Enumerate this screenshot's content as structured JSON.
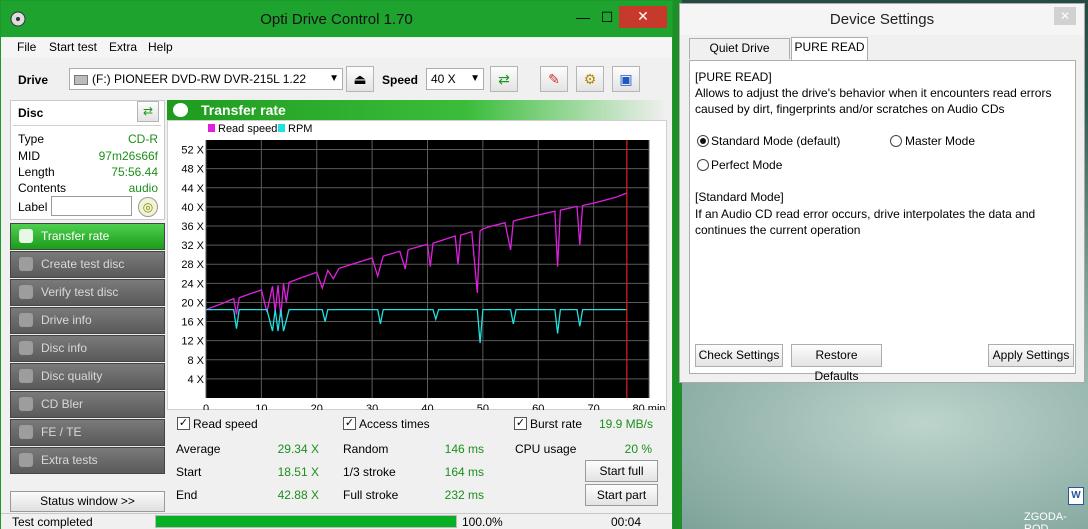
{
  "main_window": {
    "title": "Opti Drive Control 1.70",
    "menu": [
      "File",
      "Start test",
      "Extra",
      "Help"
    ],
    "drive_label": "Drive",
    "drive_value": "(F:)  PIONEER DVD-RW  DVR-215L 1.22",
    "speed_label": "Speed",
    "speed_value": "40 X",
    "disc": {
      "title": "Disc",
      "rows": [
        {
          "key": "Type",
          "value": "CD-R"
        },
        {
          "key": "MID",
          "value": "97m26s66f"
        },
        {
          "key": "Length",
          "value": "75:56.44"
        },
        {
          "key": "Contents",
          "value": "audio"
        }
      ],
      "label_key": "Label",
      "label_value": ""
    },
    "nav": [
      {
        "label": "Transfer rate",
        "active": true
      },
      {
        "label": "Create test disc",
        "active": false
      },
      {
        "label": "Verify test disc",
        "active": false
      },
      {
        "label": "Drive info",
        "active": false
      },
      {
        "label": "Disc info",
        "active": false
      },
      {
        "label": "Disc quality",
        "active": false
      },
      {
        "label": "CD Bler",
        "active": false
      },
      {
        "label": "FE / TE",
        "active": false
      },
      {
        "label": "Extra tests",
        "active": false
      }
    ],
    "status_window_button": "Status window >>",
    "chart_title": "Transfer rate",
    "stats": {
      "read_speed_label": "Read speed",
      "access_times_label": "Access times",
      "burst_rate_label": "Burst rate",
      "burst_rate_value": "19.9 MB/s",
      "average_label": "Average",
      "average_value": "29.34 X",
      "start_label": "Start",
      "start_value": "18.51 X",
      "end_label": "End",
      "end_value": "42.88 X",
      "random_label": "Random",
      "random_value": "146 ms",
      "third_label": "1/3 stroke",
      "third_value": "164 ms",
      "full_label": "Full stroke",
      "full_value": "232 ms",
      "cpu_label": "CPU usage",
      "cpu_value": "20 %",
      "start_full": "Start full",
      "start_part": "Start part"
    },
    "status": {
      "text": "Test completed",
      "progress": 100,
      "progress_text": "100.0%",
      "time": "00:04"
    }
  },
  "chart_data": {
    "type": "line",
    "xlim": [
      0,
      80
    ],
    "ylim": [
      0,
      54
    ],
    "x_ticks": [
      0,
      10,
      20,
      30,
      40,
      50,
      60,
      70,
      80
    ],
    "x_tick_labels": [
      "0",
      "10",
      "20",
      "30",
      "40",
      "50",
      "60",
      "70",
      "80 min"
    ],
    "y_ticks": [
      4,
      8,
      12,
      16,
      20,
      24,
      28,
      32,
      36,
      40,
      44,
      48,
      52
    ],
    "y_tick_labels": [
      "4 X",
      "8 X",
      "12 X",
      "16 X",
      "20 X",
      "24 X",
      "28 X",
      "32 X",
      "36 X",
      "40 X",
      "44 X",
      "48 X",
      "52 X"
    ],
    "grid": true,
    "legend_position": "top-left",
    "end_marker_x": 76,
    "series": [
      {
        "name": "Read speed",
        "color": "#e020e0",
        "x": [
          0,
          3,
          5,
          5.5,
          6,
          8,
          10,
          11,
          12,
          12.5,
          13,
          13.5,
          14,
          14.5,
          15,
          17,
          20,
          21,
          22,
          23,
          24,
          25,
          30,
          31,
          32,
          35,
          36,
          36.5,
          37,
          40,
          40.5,
          41,
          45,
          45.5,
          46,
          48,
          49,
          49.5,
          50,
          51,
          54,
          55,
          55.5,
          56,
          60,
          63,
          63.5,
          64,
          67,
          67.5,
          68,
          70,
          72,
          74,
          76
        ],
        "y": [
          18.5,
          19.8,
          20.8,
          17.5,
          21,
          21.8,
          22.6,
          18,
          23.4,
          18,
          23.6,
          17,
          24,
          20,
          24.2,
          25.1,
          26.3,
          23,
          26.7,
          25,
          27.1,
          27.5,
          29.3,
          25.5,
          29.7,
          30.7,
          27,
          31,
          31.2,
          32.2,
          27.5,
          32.4,
          33.9,
          28,
          34.1,
          34.8,
          22,
          35,
          35.4,
          35.8,
          36.7,
          31,
          37,
          37.2,
          38.3,
          39.1,
          27.5,
          39.3,
          40.1,
          32,
          40.3,
          40.8,
          41.4,
          42,
          42.9
        ]
      },
      {
        "name": "RPM",
        "color": "#20e0e0",
        "x": [
          0,
          5,
          5.5,
          6,
          11,
          12,
          12.5,
          13,
          13.5,
          14,
          15,
          21,
          21.5,
          22,
          31,
          31.5,
          32,
          41,
          41.5,
          42,
          49,
          49.5,
          50,
          55,
          55.5,
          56,
          63,
          63.5,
          64,
          67,
          67.5,
          68,
          76
        ],
        "y": [
          18.5,
          18.5,
          14.5,
          18.5,
          18.5,
          14,
          18.5,
          14,
          18.5,
          14,
          18.5,
          18.5,
          16,
          18.5,
          18.5,
          15.5,
          18.5,
          18.5,
          16.5,
          18.5,
          18.5,
          11.5,
          18.5,
          18.5,
          15.5,
          18.5,
          18.5,
          13.5,
          18.5,
          18.5,
          15,
          18.5,
          18.5
        ]
      }
    ]
  },
  "device_settings": {
    "title": "Device Settings",
    "tabs": [
      "Quiet Drive Feature",
      "PURE READ"
    ],
    "heading": "[PURE READ]",
    "description": "Allows to adjust the drive's behavior when it encounters read errors caused by dirt, fingerprints and/or scratches on Audio CDs",
    "options": {
      "standard": "Standard Mode (default)",
      "master": "Master Mode",
      "perfect": "Perfect Mode"
    },
    "selected_option": "standard",
    "mode_heading": "[Standard Mode]",
    "mode_description": "If an Audio CD read error occurs, drive interpolates the data and continues the current operation",
    "buttons": {
      "check": "Check Settings",
      "restore": "Restore Defaults",
      "apply": "Apply Settings"
    }
  },
  "taskbar": {
    "label": "ZGODA-ROD"
  }
}
